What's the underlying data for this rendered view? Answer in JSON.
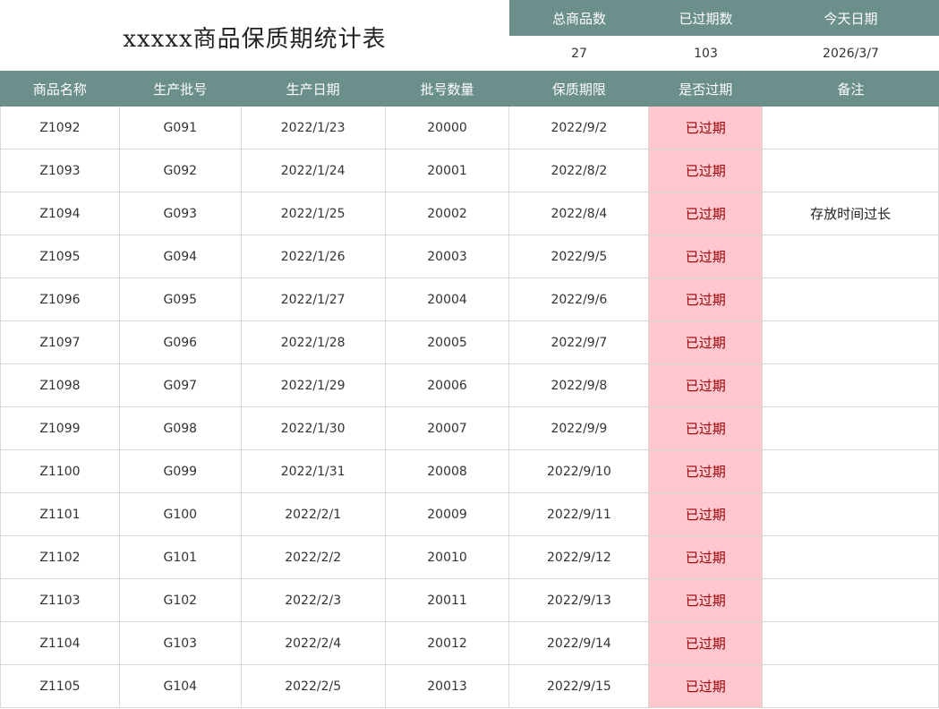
{
  "title": "xxxxx商品保质期统计表",
  "summary": {
    "headers": [
      "总商品数",
      "已过期数",
      "今天日期"
    ],
    "values": [
      "27",
      "103",
      "2026/3/7"
    ]
  },
  "table": {
    "columns": [
      "商品名称",
      "生产批号",
      "生产日期",
      "批号数量",
      "保质期限",
      "是否过期",
      "备注"
    ],
    "rows": [
      [
        "Z1092",
        "G091",
        "2022/1/23",
        "20000",
        "2022/9/2",
        "已过期",
        ""
      ],
      [
        "Z1093",
        "G092",
        "2022/1/24",
        "20001",
        "2022/8/2",
        "已过期",
        ""
      ],
      [
        "Z1094",
        "G093",
        "2022/1/25",
        "20002",
        "2022/8/4",
        "已过期",
        "存放时间过长"
      ],
      [
        "Z1095",
        "G094",
        "2022/1/26",
        "20003",
        "2022/9/5",
        "已过期",
        ""
      ],
      [
        "Z1096",
        "G095",
        "2022/1/27",
        "20004",
        "2022/9/6",
        "已过期",
        ""
      ],
      [
        "Z1097",
        "G096",
        "2022/1/28",
        "20005",
        "2022/9/7",
        "已过期",
        ""
      ],
      [
        "Z1098",
        "G097",
        "2022/1/29",
        "20006",
        "2022/9/8",
        "已过期",
        ""
      ],
      [
        "Z1099",
        "G098",
        "2022/1/30",
        "20007",
        "2022/9/9",
        "已过期",
        ""
      ],
      [
        "Z1100",
        "G099",
        "2022/1/31",
        "20008",
        "2022/9/10",
        "已过期",
        ""
      ],
      [
        "Z1101",
        "G100",
        "2022/2/1",
        "20009",
        "2022/9/11",
        "已过期",
        ""
      ],
      [
        "Z1102",
        "G101",
        "2022/2/2",
        "20010",
        "2022/9/12",
        "已过期",
        ""
      ],
      [
        "Z1103",
        "G102",
        "2022/2/3",
        "20011",
        "2022/9/13",
        "已过期",
        ""
      ],
      [
        "Z1104",
        "G103",
        "2022/2/4",
        "20012",
        "2022/9/14",
        "已过期",
        ""
      ],
      [
        "Z1105",
        "G104",
        "2022/2/5",
        "20013",
        "2022/9/15",
        "已过期",
        ""
      ]
    ]
  },
  "colors": {
    "header_bg": "#6b8f8a",
    "expired_bg": "#ffc7ce",
    "expired_text": "#9c0006"
  }
}
